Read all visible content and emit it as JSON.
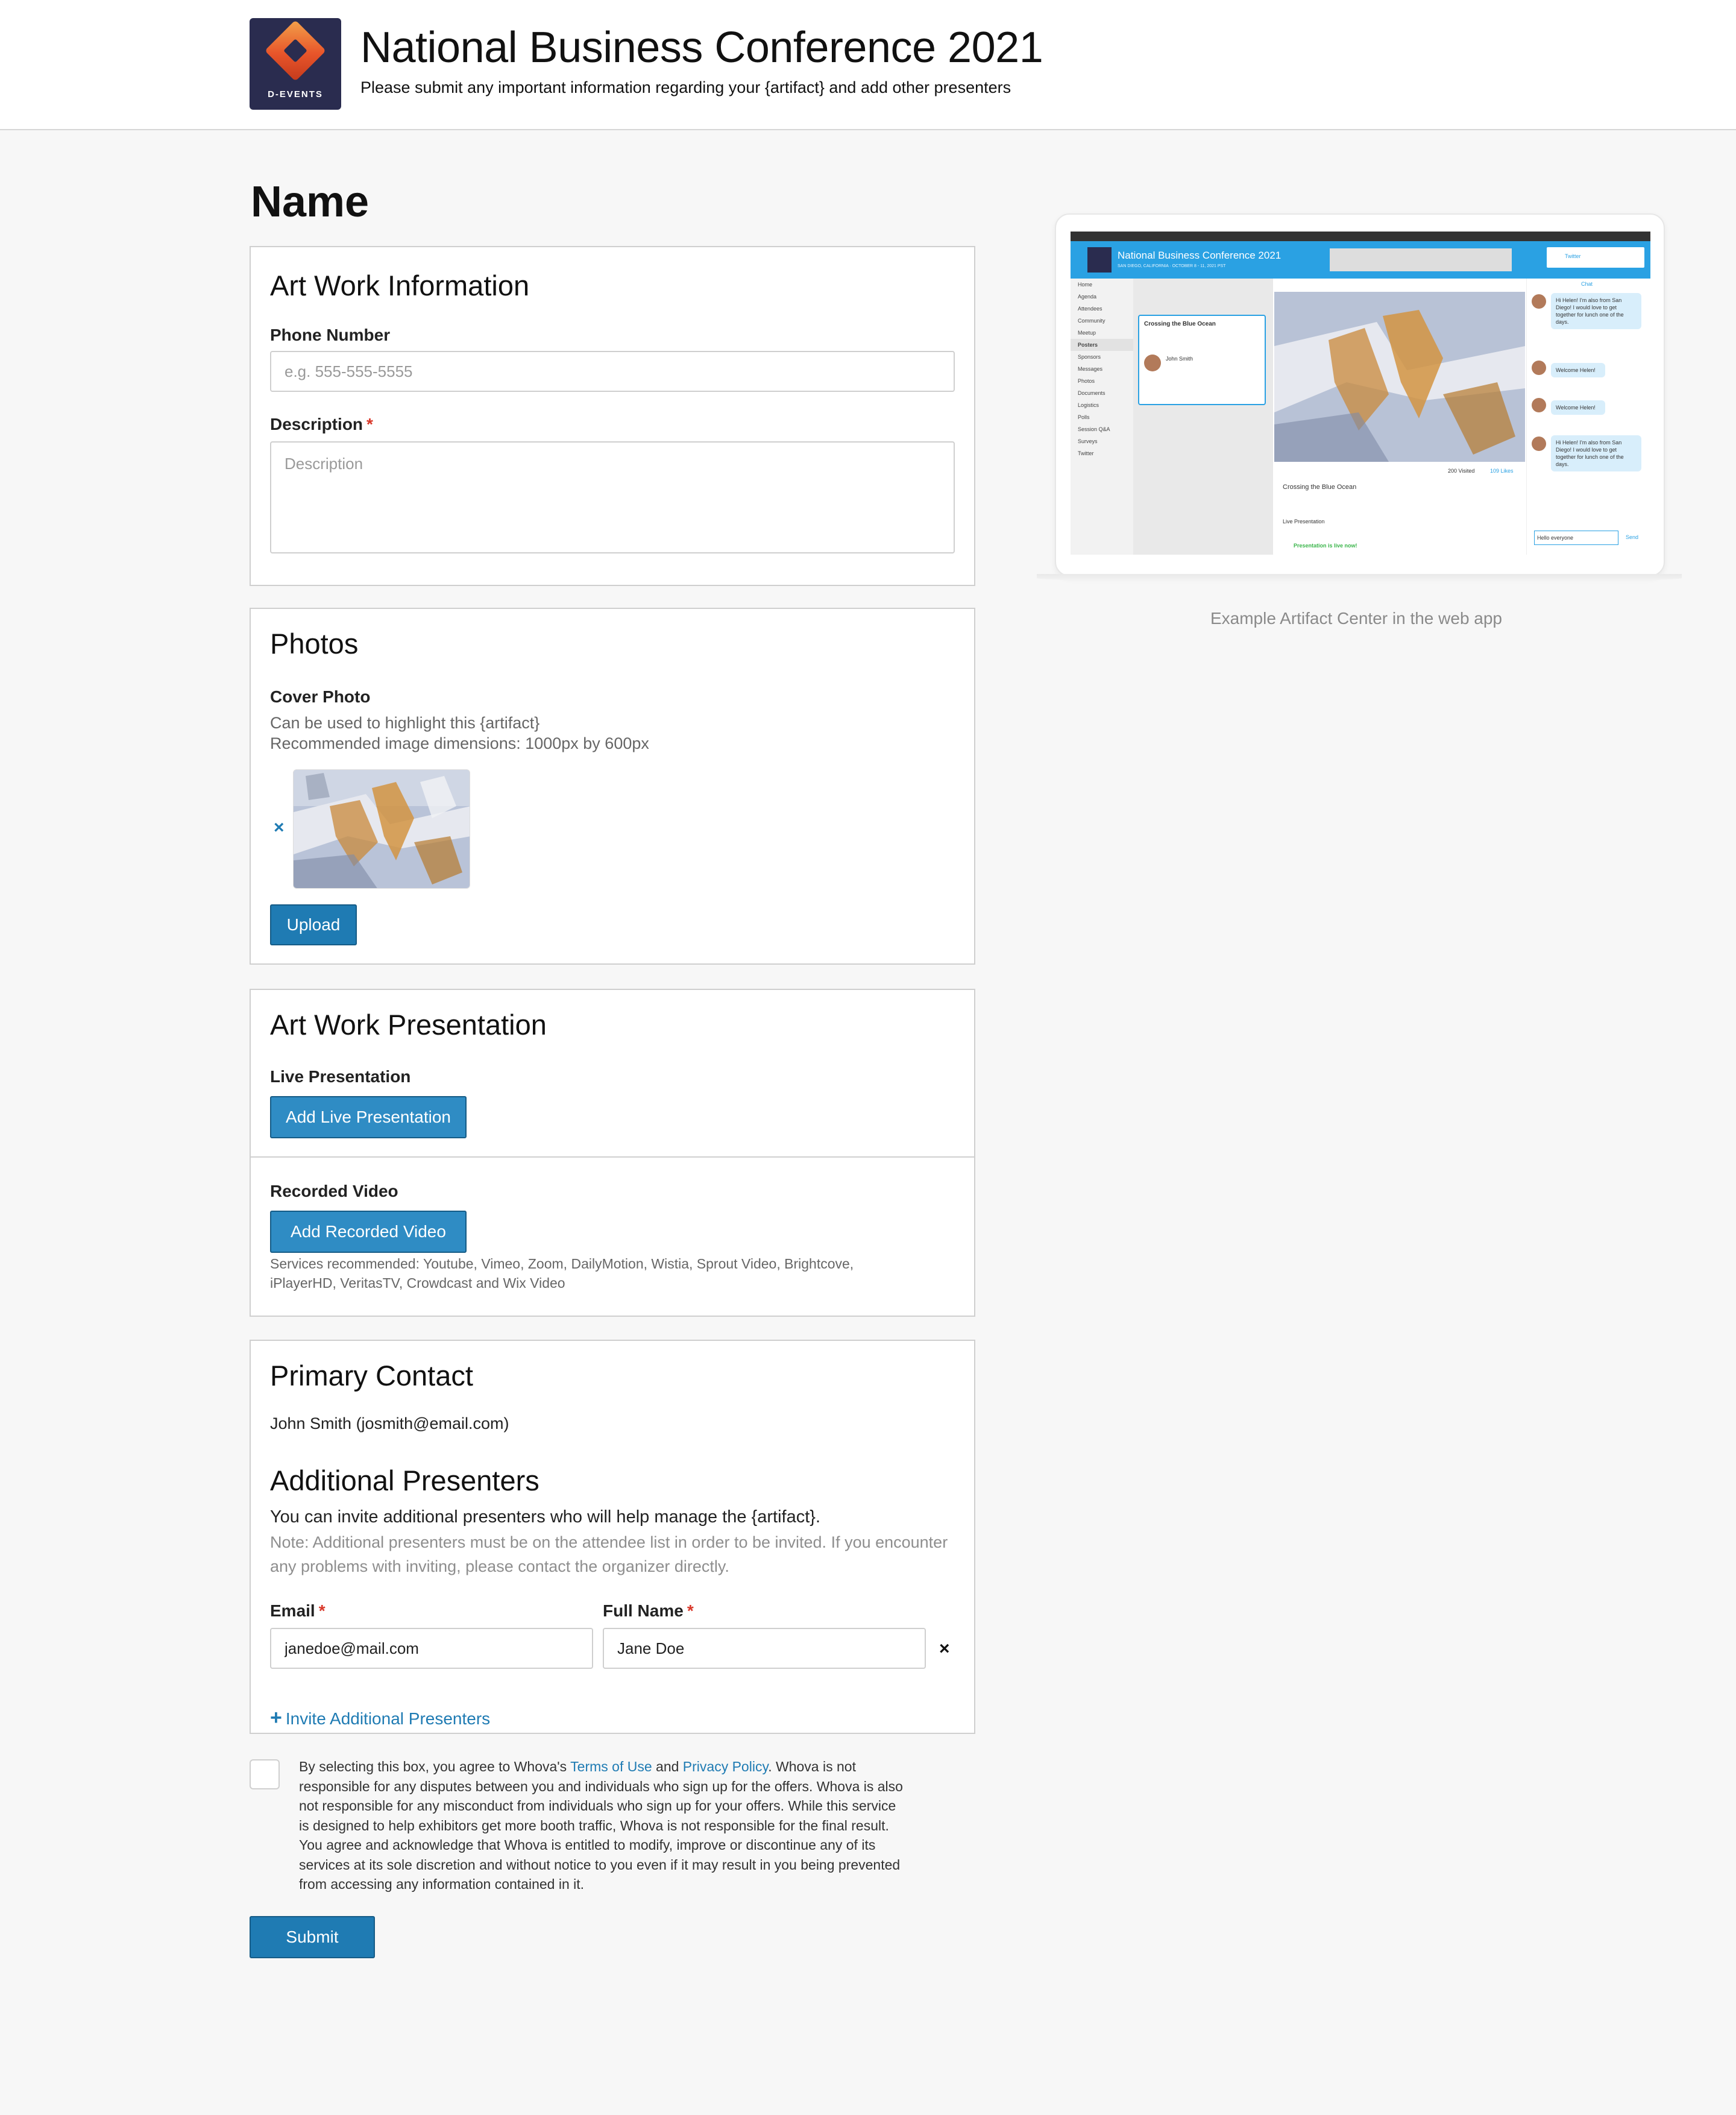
{
  "header": {
    "logo_text": "D-EVENTS",
    "title": "National Business Conference 2021",
    "subtitle": "Please submit any important information regarding your {artifact} and add other presenters"
  },
  "page_title": "Name",
  "artwork_info": {
    "title": "Art Work Information",
    "phone_label": "Phone Number",
    "phone_placeholder": "e.g. 555-555-5555",
    "description_label": "Description",
    "required_mark": "*",
    "description_placeholder": "Description"
  },
  "photos": {
    "title": "Photos",
    "cover_label": "Cover Photo",
    "cover_help_1": "Can be used to highlight this {artifact}",
    "cover_help_2": "Recommended image dimensions: 1000px by 600px",
    "remove_symbol": "×",
    "upload_label": "Upload"
  },
  "presentation": {
    "title": "Art Work Presentation",
    "live_label": "Live Presentation",
    "live_button": "Add Live Presentation",
    "recorded_label": "Recorded Video",
    "recorded_button": "Add Recorded Video",
    "services_line_1": "Services recommended: Youtube, Vimeo, Zoom, DailyMotion, Wistia, Sprout Video, Brightcove,",
    "services_line_2": "iPlayerHD, VeritasTV, Crowdcast and Wix Video"
  },
  "contact": {
    "title": "Primary Contact",
    "primary": "John Smith (josmith@email.com)",
    "additional_title": "Additional Presenters",
    "additional_desc": "You can invite additional presenters who will help manage the {artifact}.",
    "note": "Note: Additional presenters must be on the attendee list in order to be invited. If you encounter any problems with inviting, please contact the organizer directly.",
    "email_label": "Email",
    "name_label": "Full Name",
    "email_value": "janedoe@mail.com",
    "name_value": "Jane Doe",
    "remove_symbol": "×",
    "invite_plus": "+",
    "invite_label": "Invite Additional Presenters"
  },
  "agreement": {
    "prefix": "By selecting this box, you agree to Whova's ",
    "terms": "Terms of Use",
    "and": " and ",
    "privacy": "Privacy Policy",
    "body": ". Whova is not responsible for any disputes between you and individuals who sign up for the offers. Whova is also not responsible for any misconduct from individuals who sign up for your offers. While this service is designed to help exhibitors get more booth traffic, Whova is not responsible for the final result. You agree and acknowledge that Whova is entitled to modify, improve or discontinue any of its services at its sole discretion and without notice to you even if it may result in you being prevented from accessing any information contained in it."
  },
  "submit_label": "Submit",
  "preview": {
    "caption": "Example Artifact Center in the web app",
    "screen_title": "National Business Conference 2021",
    "screen_sub": "SAN DIEGO, CALIFORNIA · OCTOBER 8 - 11, 2021 PST",
    "twitter": "Twitter",
    "nav": [
      "Home",
      "Agenda",
      "Attendees",
      "Community",
      "Meetup",
      "Posters",
      "Sponsors",
      "Messages",
      "Photos",
      "Documents",
      "Logistics",
      "Polls",
      "Session Q&A",
      "Surveys",
      "Twitter"
    ],
    "poster_title": "Crossing the Blue Ocean",
    "poster_author": "John Smith",
    "stats": "200 Visited",
    "likes": "109 Likes",
    "live": "Live Presentation",
    "live_now": "Presentation is live now!",
    "chat_label": "Chat",
    "chat_1": "Hi Helen! I'm also from San Diego! I would love to get together for lunch one of the days.",
    "chat_2": "Welcome Helen!",
    "chat_3": "Welcome Helen!",
    "chat_input": "Hello everyone",
    "send": "Send"
  }
}
